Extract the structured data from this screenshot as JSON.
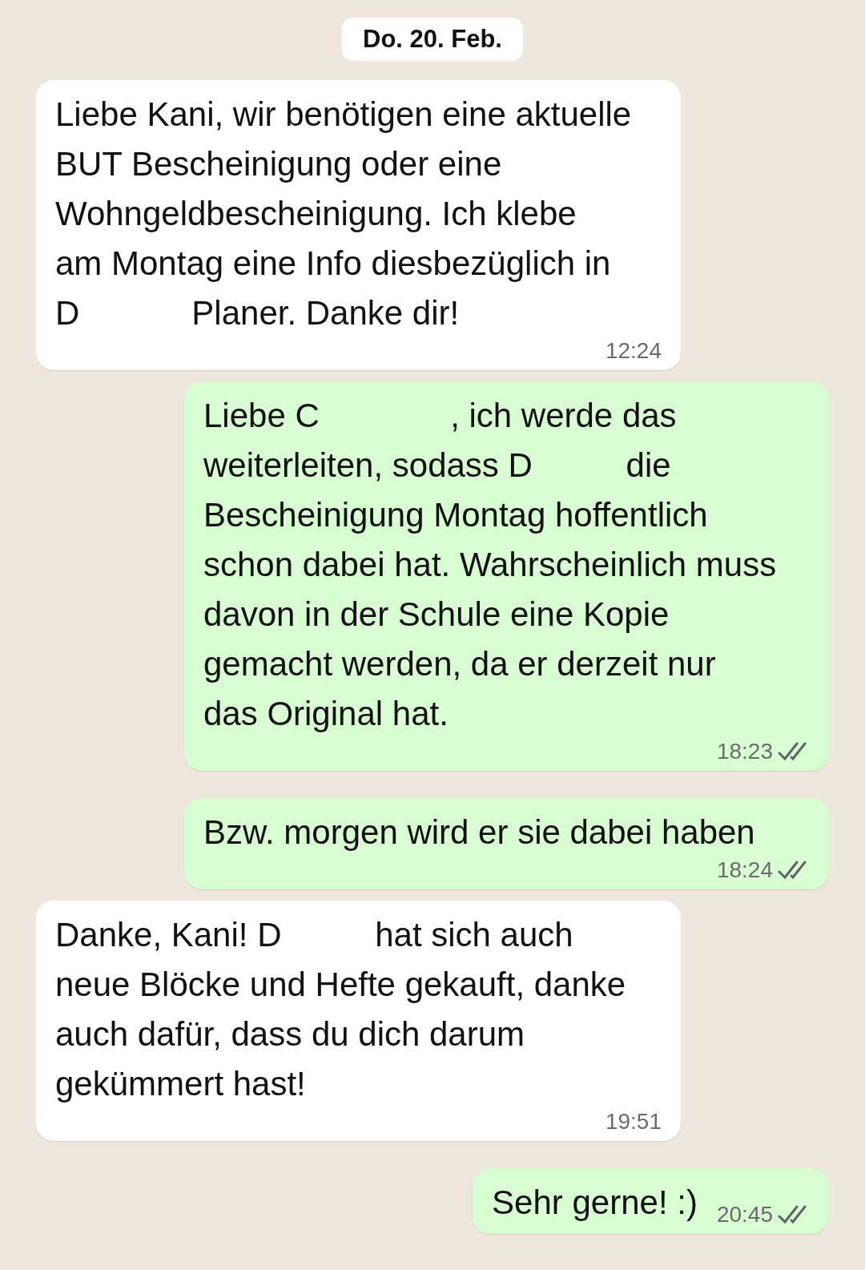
{
  "date_chip": "Do. 20. Feb.",
  "messages": [
    {
      "kind": "incoming",
      "text": "Liebe Kani, wir benötigen eine aktuelle\nBUT Bescheinigung oder eine\nWohngeldbescheinigung. Ich klebe\nam Montag eine Info diesbezüglich in\nD            Planer. Danke dir!",
      "time": "12:24"
    },
    {
      "kind": "outgoing",
      "text": "Liebe C              , ich werde das\nweiterleiten, sodass D          die\nBescheinigung Montag hoffentlich\nschon dabei hat. Wahrscheinlich muss\ndavon in der Schule eine Kopie\ngemacht werden, da er derzeit nur\ndas Original hat.",
      "time": "18:23"
    },
    {
      "kind": "outgoing",
      "text": "Bzw. morgen wird er sie dabei haben",
      "time": "18:24"
    },
    {
      "kind": "incoming",
      "text": "Danke, Kani! D          hat sich auch\nneue Blöcke und Hefte gekauft, danke\nauch dafür, dass du dich darum\ngekümmert hast!",
      "time": "19:51"
    },
    {
      "kind": "outgoing",
      "text": "Sehr gerne! :)",
      "time": "20:45"
    }
  ]
}
